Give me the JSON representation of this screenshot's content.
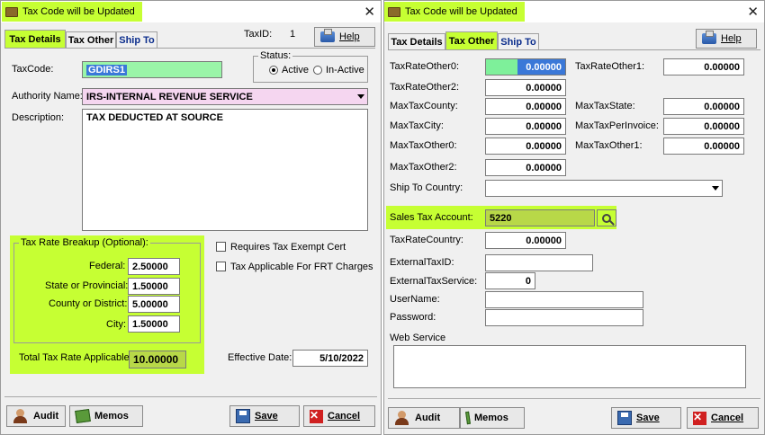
{
  "left": {
    "title": "Tax Code  will be Updated",
    "tabs": [
      "Tax Details",
      "Tax Other",
      "Ship To"
    ],
    "taxid_label": "TaxID:",
    "taxid_value": "1",
    "help_label": "Help",
    "taxcode_label": "TaxCode:",
    "taxcode_value": "GDIRS1",
    "status_label": "Status:",
    "active_label": "Active",
    "inactive_label": "In-Active",
    "authority_label": "Authority Name:",
    "authority_value": "IRS-INTERNAL REVENUE SERVICE",
    "description_label": "Description:",
    "description_value": "TAX DEDUCTED AT SOURCE",
    "breakup_title": "Tax Rate Breakup (Optional):",
    "federal_label": "Federal:",
    "federal_value": "2.50000",
    "state_label": "State or Provincial:",
    "state_value": "1.50000",
    "county_label": "County or District:",
    "county_value": "5.00000",
    "city_label": "City:",
    "city_value": "1.50000",
    "total_label": "Total Tax Rate Applicable:",
    "total_value": "10.00000",
    "exempt_label": "Requires Tax Exempt Cert",
    "frt_label": "Tax Applicable For FRT Charges",
    "effective_label": "Effective Date:",
    "effective_value": "5/10/2022",
    "audit_label": "Audit",
    "memos_label": "Memos",
    "save_label": "Save",
    "cancel_label": "Cancel"
  },
  "right": {
    "title": "Tax Code  will be Updated",
    "tabs": [
      "Tax Details",
      "Tax Other",
      "Ship To"
    ],
    "help_label": "Help",
    "taxrateother0_label": "TaxRateOther0:",
    "taxrateother0_value": "0.00000",
    "taxrateother1_label": "TaxRateOther1:",
    "taxrateother1_value": "0.00000",
    "taxrateother2_label": "TaxRateOther2:",
    "taxrateother2_value": "0.00000",
    "maxtaxcounty_label": "MaxTaxCounty:",
    "maxtaxcounty_value": "0.00000",
    "maxtaxstate_label": "MaxTaxState:",
    "maxtaxstate_value": "0.00000",
    "maxtaxcity_label": "MaxTaxCity:",
    "maxtaxcity_value": "0.00000",
    "maxtaxperinvoice_label": "MaxTaxPerInvoice:",
    "maxtaxperinvoice_value": "0.00000",
    "maxtaxother0_label": "MaxTaxOther0:",
    "maxtaxother0_value": "0.00000",
    "maxtaxother1_label": "MaxTaxOther1:",
    "maxtaxother1_value": "0.00000",
    "maxtaxother2_label": "MaxTaxOther2:",
    "maxtaxother2_value": "0.00000",
    "shipto_country_label": "Ship To Country:",
    "shipto_country_value": "",
    "sales_tax_label": "Sales Tax Account:",
    "sales_tax_value": "5220",
    "taxratecountry_label": "TaxRateCountry:",
    "taxratecountry_value": "0.00000",
    "externaltaxid_label": "ExternalTaxID:",
    "externaltaxid_value": "",
    "externaltaxservice_label": "ExternalTaxService:",
    "externaltaxservice_value": "0",
    "username_label": "UserName:",
    "username_value": "",
    "password_label": "Password:",
    "password_value": "",
    "webservice_label": "Web Service",
    "webservice_value": "",
    "audit_label": "Audit",
    "memos_label": "Memos",
    "save_label": "Save",
    "cancel_label": "Cancel"
  },
  "colors": {
    "highlight": "#c6ff33",
    "selection": "#3a78d8",
    "authority_bg": "#f5d6f0",
    "tab_blue": "#0b2d8c"
  }
}
